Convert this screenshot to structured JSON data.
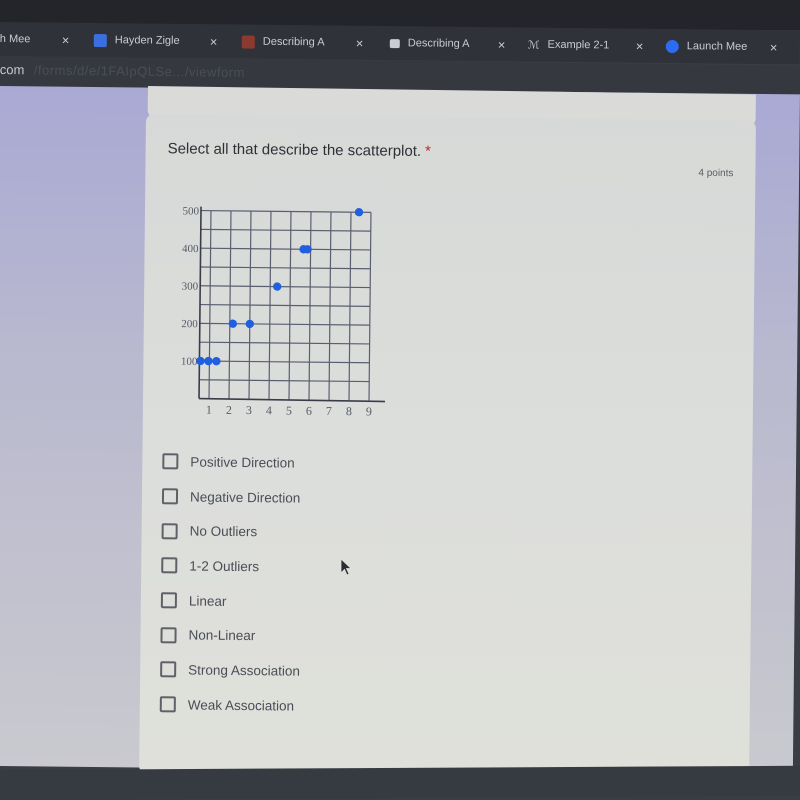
{
  "browser": {
    "tabs": [
      {
        "label": "h Mee",
        "icon": "meet-icon",
        "icon_color": "#3a3d44"
      },
      {
        "label": "Hayden Zigle",
        "icon": "docs-icon",
        "icon_color": "#3b6fe0"
      },
      {
        "label": "Describing A",
        "icon": "classroom-icon",
        "icon_color": "#8a3a2f"
      },
      {
        "label": "Describing A",
        "icon": "forms-icon",
        "icon_color": "#c9ccd2"
      },
      {
        "label": "Example 2-1",
        "icon": "handwriting-icon",
        "icon_color": "#c9ccd2"
      },
      {
        "label": "Launch Mee",
        "icon": "zoom-icon",
        "icon_color": "#2d6cf0"
      }
    ],
    "close_glyph": "×",
    "url_host": "com",
    "url_path": "/forms/d/e/1FAIpQLSe.../viewform"
  },
  "question": {
    "title": "Select all that describe the scatterplot.",
    "required_mark": "*",
    "points": "4 points"
  },
  "options": [
    {
      "label": "Positive Direction",
      "checked": false
    },
    {
      "label": "Negative Direction",
      "checked": false
    },
    {
      "label": "No Outliers",
      "checked": false
    },
    {
      "label": "1-2 Outliers",
      "checked": false
    },
    {
      "label": "Linear",
      "checked": false
    },
    {
      "label": "Non-Linear",
      "checked": false
    },
    {
      "label": "Strong Association",
      "checked": false
    },
    {
      "label": "Weak Association",
      "checked": false
    }
  ],
  "chart_data": {
    "type": "scatter",
    "title": "",
    "xlabel": "",
    "ylabel": "",
    "xlim": [
      0.5,
      9.5
    ],
    "ylim": [
      0,
      500
    ],
    "x_ticks": [
      "1",
      "2",
      "3",
      "4",
      "5",
      "6",
      "7",
      "8",
      "9"
    ],
    "y_ticks": [
      "100",
      "200",
      "300",
      "400",
      "500"
    ],
    "grid": true,
    "point_color": "#1f5fe0",
    "points": [
      {
        "x": 0.55,
        "y": 100
      },
      {
        "x": 0.95,
        "y": 100
      },
      {
        "x": 1.35,
        "y": 100
      },
      {
        "x": 2.15,
        "y": 200
      },
      {
        "x": 3.0,
        "y": 200
      },
      {
        "x": 4.35,
        "y": 300
      },
      {
        "x": 5.65,
        "y": 400
      },
      {
        "x": 5.85,
        "y": 400
      },
      {
        "x": 8.4,
        "y": 500
      }
    ]
  }
}
